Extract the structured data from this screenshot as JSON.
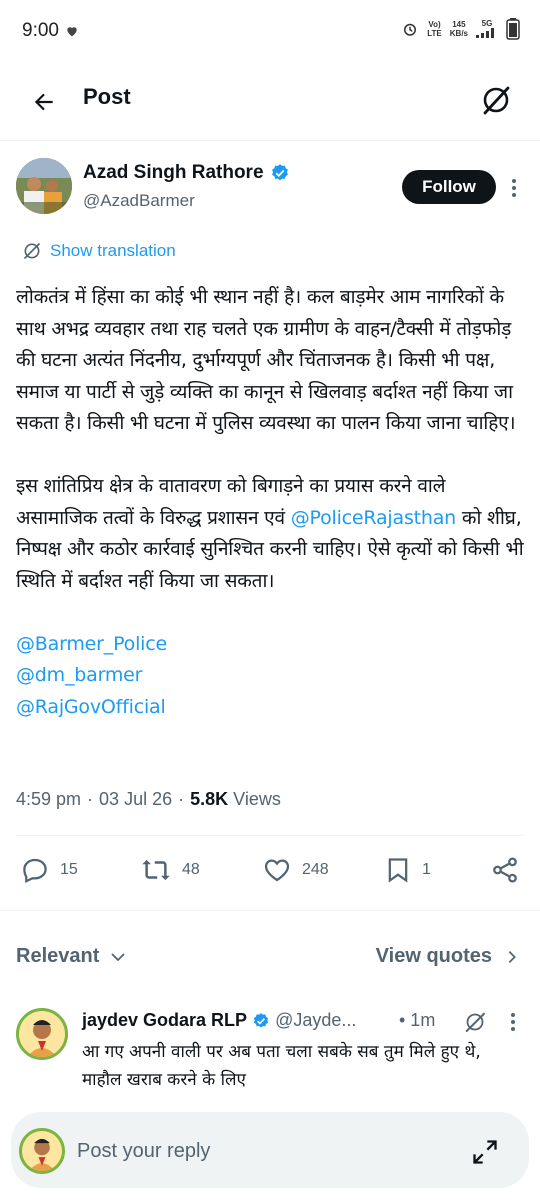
{
  "status_bar": {
    "time": "9:00",
    "network_top": "Vo)",
    "network_bottom": "LTE",
    "speed_top": "145",
    "speed_bottom": "KB/s",
    "signal_label": "5G"
  },
  "header": {
    "title": "Post"
  },
  "author": {
    "name": "Azad Singh Rathore",
    "handle": "@AzadBarmer",
    "follow_label": "Follow"
  },
  "show_translation": "Show translation",
  "tweet": {
    "paragraph1": "लोकतंत्र में हिंसा का कोई भी स्थान नहीं है। कल बाड़मेर आम नागरिकों के साथ अभद्र व्यवहार तथा राह चलते एक ग्रामीण के वाहन/टैक्सी में तोड़फोड़ की घटना अत्यंत निंदनीय, दुर्भाग्यपूर्ण और चिंताजनक है। किसी भी पक्ष, समाज या पार्टी से जुड़े व्यक्ति का कानून से खिलवाड़ बर्दाश्त नहीं किया जा सकता है। किसी भी घटना में पुलिस व्यवस्था का पालन किया जाना चाहिए।",
    "paragraph2_before": "इस शांतिप्रिय क्षेत्र के वातावरण को बिगाड़ने का प्रयास करने वाले असामाजिक तत्वों के विरुद्ध प्रशासन एवं ",
    "paragraph2_mention": "@PoliceRajasthan",
    "paragraph2_after": " को शीघ्र, निष्पक्ष और कठोर कार्रवाई सुनिश्चित करनी चाहिए। ऐसे कृत्यों को किसी भी स्थिति में बर्दाश्त नहीं किया जा सकता।",
    "mentions": [
      "@Barmer_Police",
      "@dm_barmer",
      "@RajGovOfficial"
    ]
  },
  "meta": {
    "time": "4:59 pm",
    "date": "03 Jul 26",
    "views_count": "5.8K",
    "views_label": "Views"
  },
  "actions": {
    "replies": "15",
    "reposts": "48",
    "likes": "248",
    "bookmarks": "1"
  },
  "sort": {
    "relevant_label": "Relevant",
    "view_quotes_label": "View quotes"
  },
  "reply": {
    "name": "jaydev Godara RLP",
    "handle": "@Jayde...",
    "time": "• 1m",
    "text": "आ गए अपनी वाली पर अब पता चला सबके सब तुम मिले हुए थे, माहौल खराब करने के लिए"
  },
  "reply_bar": {
    "placeholder": "Post your reply"
  },
  "colors": {
    "accent": "#1d9bf0",
    "text": "#0f1419",
    "muted": "#536471",
    "follow_bg": "#0f1419"
  }
}
